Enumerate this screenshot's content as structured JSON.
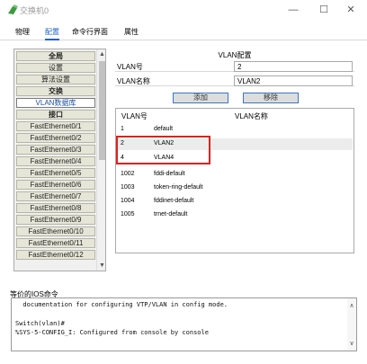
{
  "window": {
    "title": "交换机0",
    "app_icon": "switch-icon"
  },
  "controls": {
    "minimize": "—",
    "maximize": "☐",
    "close": "✕"
  },
  "tabs": [
    {
      "label": "物理",
      "active": false
    },
    {
      "label": "配置",
      "active": true
    },
    {
      "label": "命令行界面",
      "active": false
    },
    {
      "label": "属性",
      "active": false
    }
  ],
  "sidebar": {
    "items": [
      {
        "label": "全局",
        "bold": true,
        "selected": false
      },
      {
        "label": "设置",
        "bold": false,
        "selected": false
      },
      {
        "label": "算法设置",
        "bold": false,
        "selected": false
      },
      {
        "label": "交换",
        "bold": true,
        "selected": false
      },
      {
        "label": "VLAN数据库",
        "bold": false,
        "selected": true
      },
      {
        "label": "接口",
        "bold": true,
        "selected": false
      },
      {
        "label": "FastEthernet0/1",
        "bold": false,
        "selected": false
      },
      {
        "label": "FastEthernet0/2",
        "bold": false,
        "selected": false
      },
      {
        "label": "FastEthernet0/3",
        "bold": false,
        "selected": false
      },
      {
        "label": "FastEthernet0/4",
        "bold": false,
        "selected": false
      },
      {
        "label": "FastEthernet0/5",
        "bold": false,
        "selected": false
      },
      {
        "label": "FastEthernet0/6",
        "bold": false,
        "selected": false
      },
      {
        "label": "FastEthernet0/7",
        "bold": false,
        "selected": false
      },
      {
        "label": "FastEthernet0/8",
        "bold": false,
        "selected": false
      },
      {
        "label": "FastEthernet0/9",
        "bold": false,
        "selected": false
      },
      {
        "label": "FastEthernet0/10",
        "bold": false,
        "selected": false
      },
      {
        "label": "FastEthernet0/11",
        "bold": false,
        "selected": false
      },
      {
        "label": "FastEthernet0/12",
        "bold": false,
        "selected": false
      }
    ]
  },
  "vlan_config": {
    "title": "VLAN配置",
    "vlan_num_label": "VLAN号",
    "vlan_num_value": "2",
    "vlan_name_label": "VLAN名称",
    "vlan_name_value": "VLAN2",
    "add_label": "添加",
    "remove_label": "移除",
    "table_headers": {
      "num": "VLAN号",
      "name": "VLAN名称"
    },
    "rows": [
      {
        "num": "1",
        "name": "default",
        "selected": false
      },
      {
        "num": "2",
        "name": "VLAN2",
        "selected": true
      },
      {
        "num": "4",
        "name": "VLAN4",
        "selected": false
      },
      {
        "num": "1002",
        "name": "fddi-default",
        "selected": false
      },
      {
        "num": "1003",
        "name": "token-ring-default",
        "selected": false
      },
      {
        "num": "1004",
        "name": "fddinet-default",
        "selected": false
      },
      {
        "num": "1005",
        "name": "trnet-default",
        "selected": false
      }
    ]
  },
  "ios": {
    "label": "等价的IOS命令",
    "lines": [
      "  documentation for configuring VTP/VLAN in config mode.",
      "",
      "Switch(vlan)#",
      "%SYS-5-CONFIG_I: Configured from console by console"
    ]
  },
  "colors": {
    "accent": "#1a63c9",
    "highlight": "#e02020"
  }
}
